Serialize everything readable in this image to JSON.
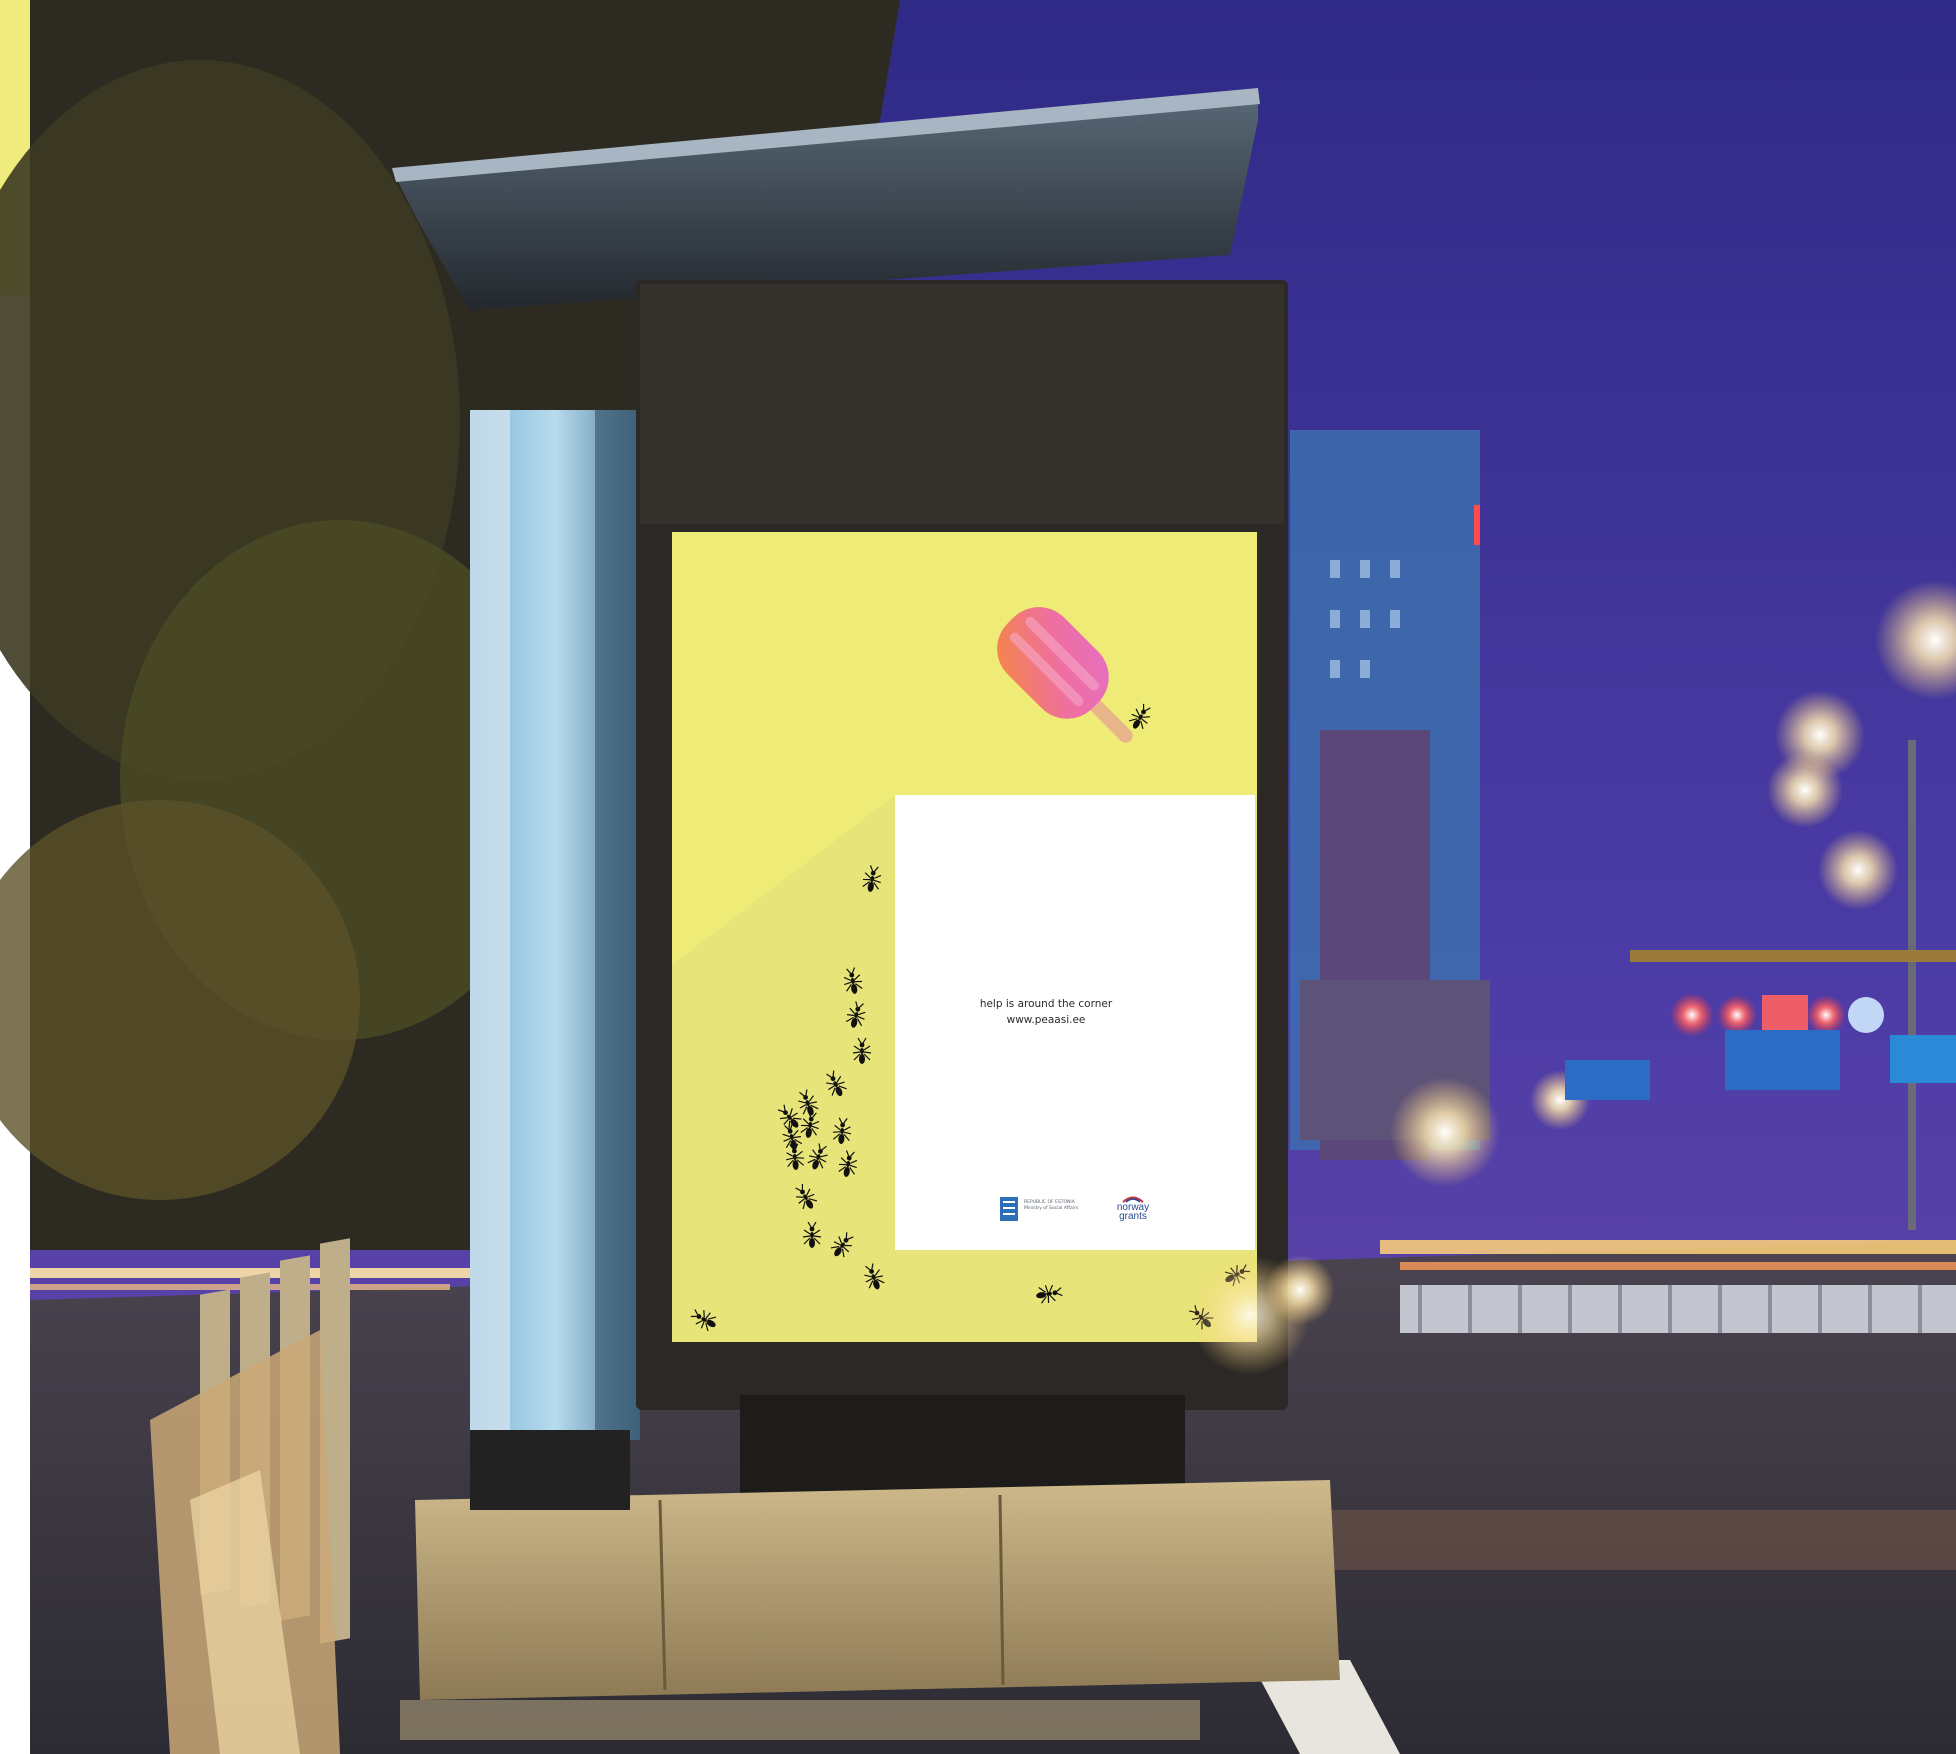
{
  "poster": {
    "tagline": "help is around the corner",
    "url": "www.peaasi.ee",
    "logos": {
      "estonia_line1": "REPUBLIC OF ESTONIA",
      "estonia_line2": "Ministry of Social Affairs",
      "norway_line1": "norway",
      "norway_line2": "grants"
    }
  },
  "colors": {
    "accent_yellow": "#efeb7c",
    "poster_yellow": "#eeec76",
    "night_sky": "#4a3a9a"
  },
  "icons": [
    "popsicle-icon",
    "ant-icon"
  ]
}
